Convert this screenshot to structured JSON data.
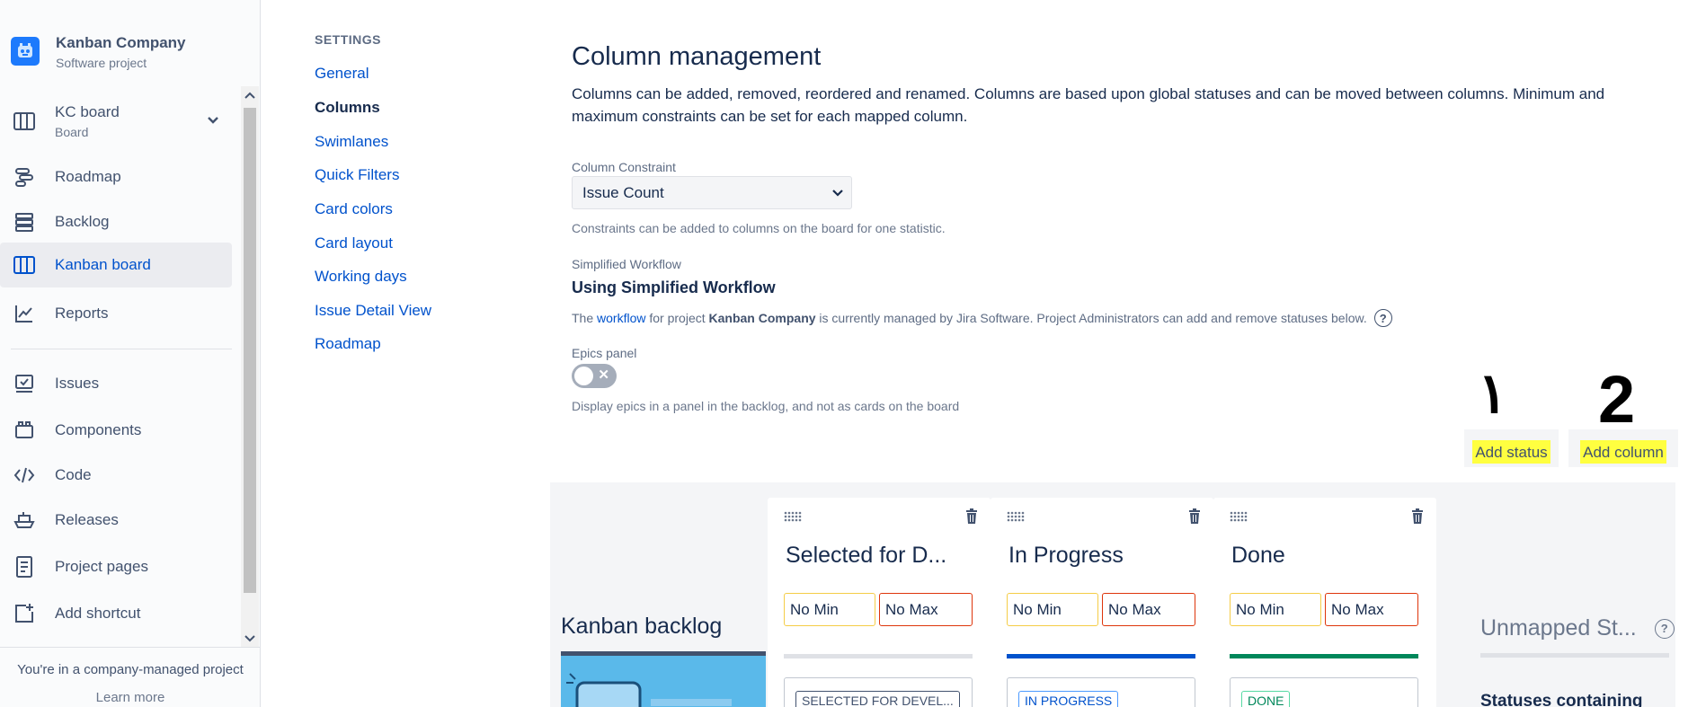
{
  "project": {
    "name": "Kanban Company",
    "type": "Software project"
  },
  "sidebar": {
    "board": {
      "label": "KC board",
      "sub": "Board"
    },
    "items": [
      {
        "label": "Roadmap",
        "icon": "roadmap-icon"
      },
      {
        "label": "Backlog",
        "icon": "backlog-icon"
      },
      {
        "label": "Kanban board",
        "icon": "kanban-board-icon",
        "active": true
      },
      {
        "label": "Reports",
        "icon": "reports-icon"
      },
      {
        "label": "Issues",
        "icon": "issues-icon"
      },
      {
        "label": "Components",
        "icon": "components-icon"
      },
      {
        "label": "Code",
        "icon": "code-icon"
      },
      {
        "label": "Releases",
        "icon": "releases-icon"
      },
      {
        "label": "Project pages",
        "icon": "project-pages-icon"
      },
      {
        "label": "Add shortcut",
        "icon": "add-shortcut-icon"
      }
    ],
    "footer_text": "You're in a company-managed project",
    "footer_link": "Learn more"
  },
  "settings": {
    "heading": "SETTINGS",
    "links": [
      "General",
      "Columns",
      "Swimlanes",
      "Quick Filters",
      "Card colors",
      "Card layout",
      "Working days",
      "Issue Detail View",
      "Roadmap"
    ],
    "current": "Columns"
  },
  "main": {
    "title": "Column management",
    "description": "Columns can be added, removed, reordered and renamed. Columns are based upon global statuses and can be moved between columns. Minimum and maximum constraints can be set for each mapped column.",
    "constraint": {
      "label": "Column Constraint",
      "value": "Issue Count",
      "hint": "Constraints can be added to columns on the board for one statistic."
    },
    "workflow": {
      "label": "Simplified Workflow",
      "title": "Using Simplified Workflow",
      "text_before": "The ",
      "link": "workflow",
      "text_mid": " for project ",
      "project": "Kanban Company",
      "text_after": " is currently managed by Jira Software. Project Administrators can add and remove statuses below."
    },
    "epics": {
      "label": "Epics panel",
      "enabled": false,
      "hint": "Display epics in a panel in the backlog, and not as cards on the board"
    },
    "buttons": {
      "add_status": "Add status",
      "add_column": "Add column"
    },
    "annotations": {
      "one": "١",
      "two": "2"
    }
  },
  "board": {
    "backlog_title": "Kanban backlog",
    "columns": [
      {
        "title": "Selected for D...",
        "min": "No Min",
        "max": "No Max",
        "bar_color": "#dfe1e6",
        "status": "SELECTED FOR DEVEL...",
        "status_color": "#42526e"
      },
      {
        "title": "In Progress",
        "min": "No Min",
        "max": "No Max",
        "bar_color": "#0052cc",
        "status": "IN PROGRESS",
        "status_color": "#0052cc"
      },
      {
        "title": "Done",
        "min": "No Min",
        "max": "No Max",
        "bar_color": "#00875a",
        "status": "DONE",
        "status_color": "#00875a"
      }
    ],
    "unmapped_title": "Unmapped St...",
    "unmapped_sub": "Statuses containing"
  }
}
